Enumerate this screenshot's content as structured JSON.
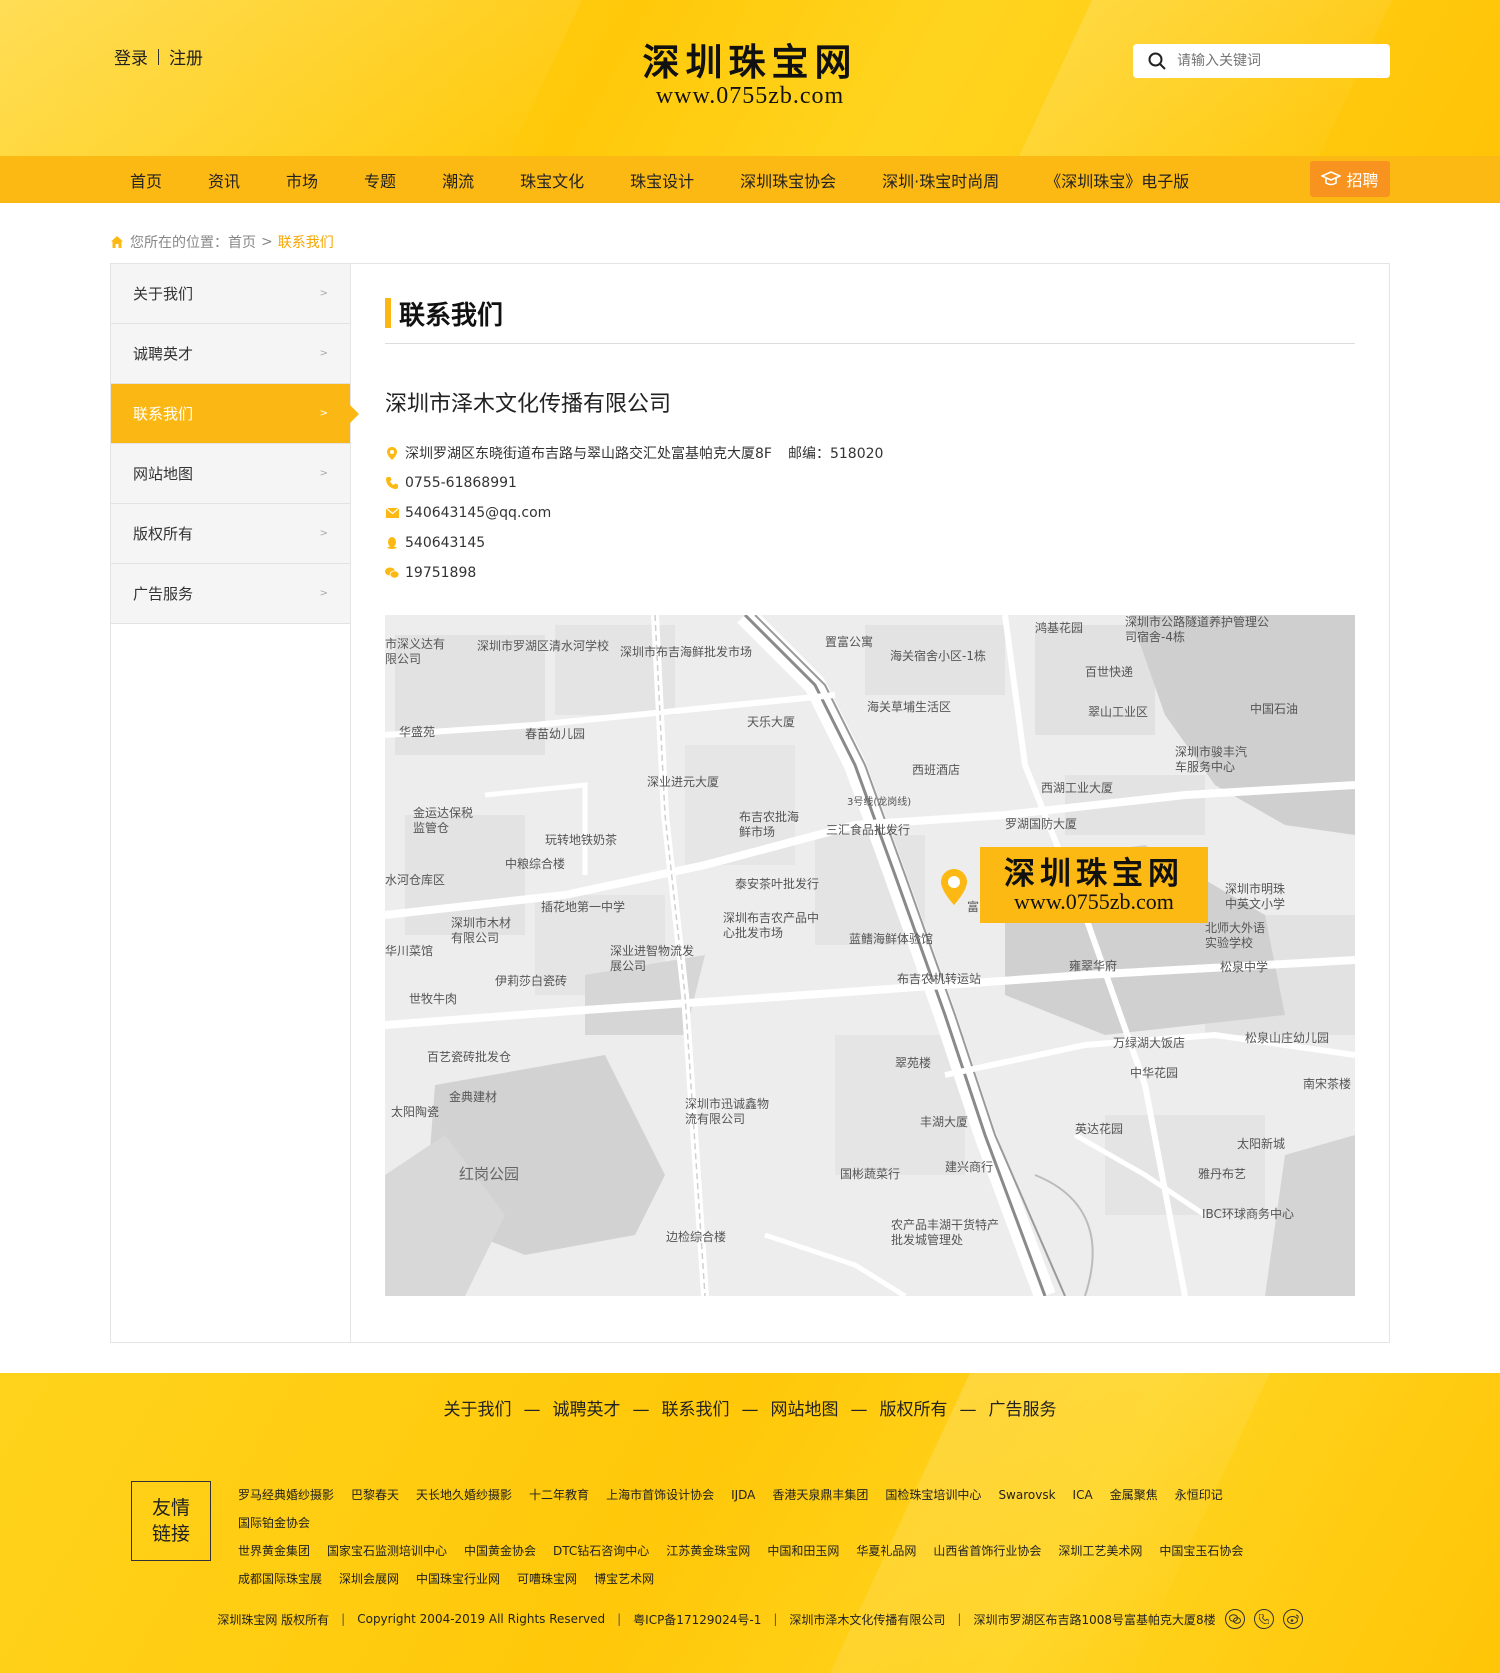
{
  "header": {
    "login": "登录",
    "register": "注册",
    "logo_cn": "深圳珠宝网",
    "logo_url": "www.0755zb.com",
    "search_placeholder": "请输入关键词",
    "nav": [
      "首页",
      "资讯",
      "市场",
      "专题",
      "潮流",
      "珠宝文化",
      "珠宝设计",
      "深圳珠宝协会",
      "深圳·珠宝时尚周",
      "《深圳珠宝》电子版"
    ],
    "recruit": "招聘"
  },
  "breadcrumb": {
    "prefix": "您所在的位置：",
    "home": "首页",
    "arrow": ">",
    "current": "联系我们"
  },
  "sidebar": {
    "items": [
      {
        "label": "关于我们"
      },
      {
        "label": "诚聘英才"
      },
      {
        "label": "联系我们"
      },
      {
        "label": "网站地图"
      },
      {
        "label": "版权所有"
      },
      {
        "label": "广告服务"
      }
    ],
    "active_index": 2
  },
  "content": {
    "title": "联系我们",
    "company": "深圳市泽木文化传播有限公司",
    "address": "深圳罗湖区东晓街道布吉路与翠山路交汇处富基帕克大厦8F",
    "postcode": "邮编：518020",
    "phone": "0755-61868991",
    "email": "540643145@qq.com",
    "qq": "540643145",
    "wechat": "19751898"
  },
  "map": {
    "badge_cn": "深圳珠宝网",
    "badge_url": "www.0755zb.com",
    "labels": [
      "深圳市罗湖区清水河学校",
      "深圳市布吉海鲜批发市场",
      "置富公寓",
      "海关宿舍小区-1栋",
      "鸿基花园",
      "深圳市公路隧道养护管理公司宿舍-4栋",
      "百世快递",
      "翠山工业区",
      "中国石油",
      "深圳市骏丰汽车服务中心",
      "华盛苑",
      "春苗幼儿园",
      "天乐大厦",
      "海关草埔生活区",
      "西班酒店",
      "西湖工业大厦",
      "深业进元大厦",
      "金运达保税监管仓",
      "玩转地铁奶茶",
      "布吉农批海鲜市场",
      "三汇食品批发行",
      "罗湖国防大厦",
      "中粮综合楼",
      "插花地第一中学",
      "泰安茶叶批发行",
      "深圳市木材有限公司",
      "深圳布吉农产品中心批发市场",
      "蓝鳍海鲜体验馆",
      "深圳市明珠中英文小学",
      "北师大外语实验学校",
      "深业进智物流发展公司",
      "伊莉莎白瓷砖",
      "布吉农机转运站",
      "雍翠华府",
      "松泉中学",
      "世牧牛肉",
      "百艺瓷砖批发仓",
      "翠苑楼",
      "万绿湖大饭店",
      "松泉山庄幼儿园",
      "金典建材",
      "太阳陶瓷",
      "深圳市迅诚鑫物流有限公司",
      "丰湖大厦",
      "中华花园",
      "英达花园",
      "南宋茶楼",
      "太阳新城",
      "红岗公园",
      "国彬蔬菜行",
      "建兴商行",
      "雅丹布艺",
      "IBC环球商务中心",
      "边检综合楼",
      "农产品丰湖干货特产批发城管理处",
      "3号线(龙岗线)",
      "华川菜馆",
      "水河仓库区",
      "市深义达有限公司",
      "富"
    ]
  },
  "footer": {
    "nav": [
      "关于我们",
      "诚聘英才",
      "联系我们",
      "网站地图",
      "版权所有",
      "广告服务"
    ],
    "nav_sep": "—",
    "friend_label_1": "友情",
    "friend_label_2": "链接",
    "links": [
      "罗马经典婚纱摄影",
      "巴黎春天",
      "天长地久婚纱摄影",
      "十二年教育",
      "上海市首饰设计协会",
      "IJDA",
      "香港天泉鼎丰集团",
      "国检珠宝培训中心",
      "Swarovsk",
      "ICA",
      "金属聚焦",
      "永恒印记",
      "国际铂金协会",
      "世界黄金集团",
      "国家宝石监测培训中心",
      "中国黄金协会",
      "DTC钻石咨询中心",
      "江苏黄金珠宝网",
      "中国和田玉网",
      "华夏礼品网",
      "山西省首饰行业协会",
      "深圳工艺美术网",
      "中国宝玉石协会",
      "成都国际珠宝展",
      "深圳会展网",
      "中国珠宝行业网",
      "可嘈珠宝网",
      "博宝艺术网"
    ],
    "copyright": [
      "深圳珠宝网 版权所有",
      "Copyright 2004-2019 All Rights Reserved",
      "粤ICP备17129024号-1",
      "深圳市泽木文化传播有限公司",
      "深圳市罗湖区布吉路1008号富基帕克大厦8楼"
    ],
    "copy_sep": "|"
  },
  "colors": {
    "brand_yellow": "#ffc90a",
    "nav_bar": "#fdb913",
    "accent_orange": "#f7931e",
    "active": "#fbb814"
  }
}
